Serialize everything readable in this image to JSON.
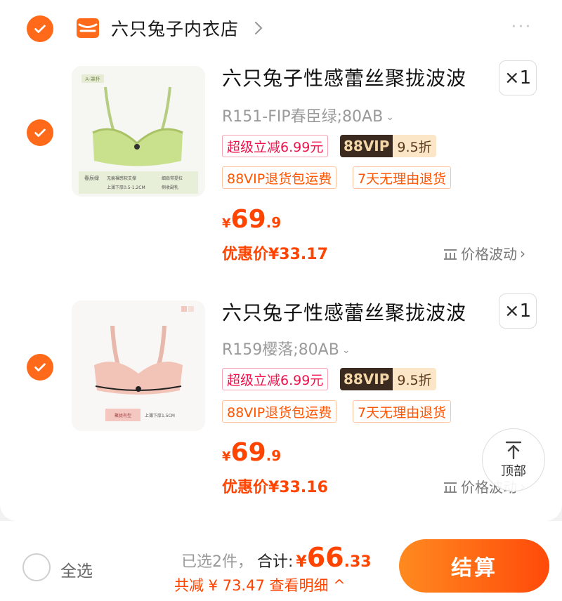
{
  "shop": {
    "name": "六只兔子内衣店",
    "more": "···"
  },
  "items": [
    {
      "title": "六只兔子性感蕾丝聚拢波波",
      "qty": "×1",
      "spec": "R151-FIP春臣绿;80AB",
      "tags": {
        "discount": "超级立减6.99元",
        "vip_a": "88VIP",
        "vip_b": "9.5折",
        "return_fee": "88VIP退货包运费",
        "return_days": "7天无理由退货"
      },
      "price": {
        "symbol": "¥",
        "int": "69",
        "dec": ".9"
      },
      "promo": "优惠价¥33.17",
      "trend": "价格波动",
      "image": {
        "badge": "A-罩杯",
        "color_name": "春辰绿",
        "f1": "无痕裸感软支撑",
        "f2": "上薄下厚0.5-1.2CM",
        "f3": "细肩带提拉",
        "f4": "侧收副乳"
      }
    },
    {
      "title": "六只兔子性感蕾丝聚拢波波",
      "qty": "×1",
      "spec": "R159樱落;80AB",
      "tags": {
        "discount": "超级立减6.99元",
        "vip_a": "88VIP",
        "vip_b": "9.5折",
        "return_fee": "88VIP退货包运费",
        "return_days": "7天无理由退货"
      },
      "price": {
        "symbol": "¥",
        "int": "69",
        "dec": ".9"
      },
      "promo": "优惠价¥33.16",
      "trend": "价格波动",
      "image": {
        "f1": "聚拢有型",
        "f2": "上薄下厚1.5CM"
      }
    }
  ],
  "top_button": {
    "label": "顶部"
  },
  "footer": {
    "select_all": "全选",
    "selected": "已选2件，",
    "total_label": "合计:",
    "total_symbol": "¥",
    "total_int": "66",
    "total_dec": ".33",
    "discount": "共减 ¥ 73.47  查看明细 ^",
    "checkout": "结算"
  },
  "colors": {
    "accent": "#ff6a1a",
    "price": "#ff4400",
    "tag_red": "#f0104a"
  }
}
